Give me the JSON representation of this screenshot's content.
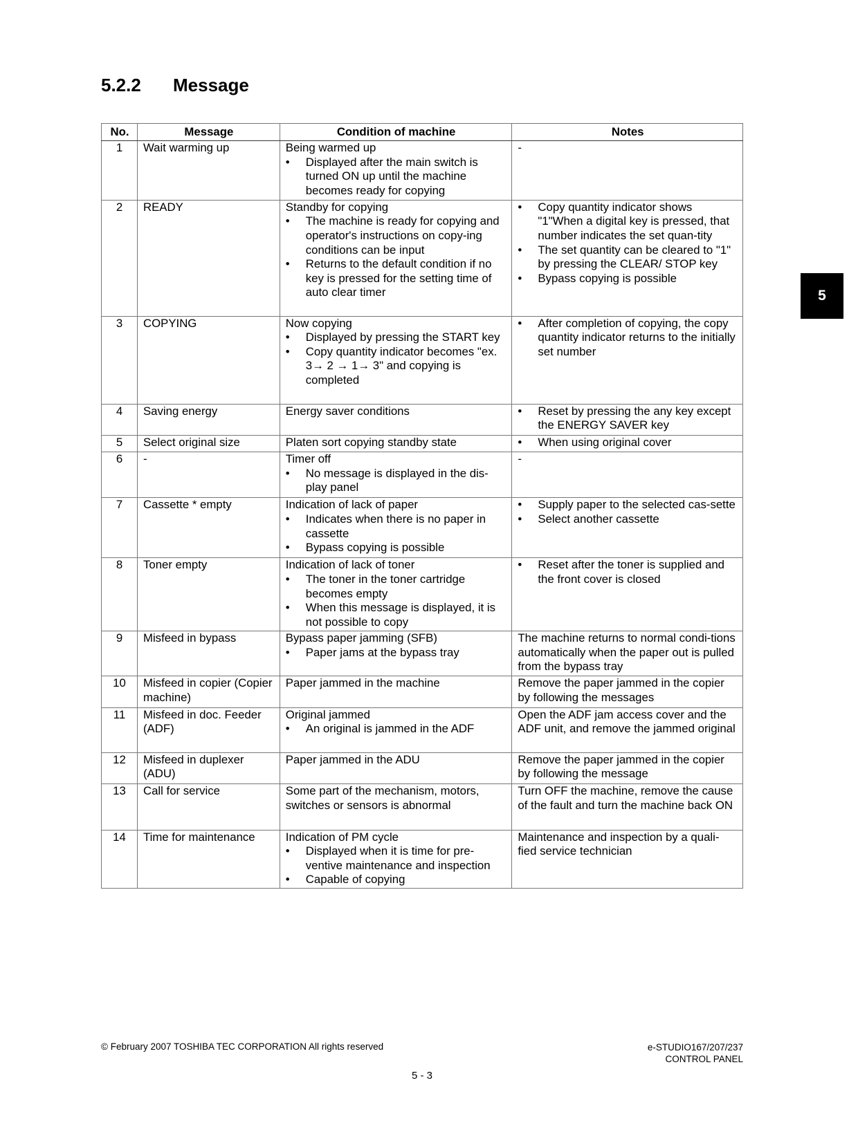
{
  "section": {
    "number": "5.2.2",
    "title": "Message"
  },
  "table": {
    "headers": [
      "No.",
      "Message",
      "Condition of machine",
      "Notes"
    ],
    "rows": [
      {
        "no": "1",
        "message": "Wait warming up",
        "condition": {
          "lead": "Being warmed up",
          "bullets": [
            "Displayed after the main switch is turned ON up until the machine becomes ready for copying"
          ]
        },
        "notes": {
          "lead": "-",
          "bullets": []
        }
      },
      {
        "no": "2",
        "message": "READY",
        "condition": {
          "lead": "Standby for copying",
          "bullets": [
            "The machine is ready for copying and operator's instructions on copy-ing conditions can be input",
            "Returns to the default condition if no key is pressed for the setting time of auto clear timer"
          ]
        },
        "notes": {
          "lead": "",
          "bullets": [
            "Copy quantity indicator shows \"1\"When a digital key is pressed, that number indicates the set quan-tity",
            "The set quantity can be cleared to \"1\" by pressing the CLEAR/ STOP key",
            "Bypass copying is possible"
          ]
        }
      },
      {
        "no": "3",
        "message": "COPYING",
        "condition": {
          "lead": "Now copying",
          "bullets": [
            "Displayed by pressing the START key",
            "Copy quantity indicator becomes \"ex. 3→ 2 → 1→ 3\" and copying is completed"
          ]
        },
        "notes": {
          "lead": "",
          "bullets": [
            "After completion of copying, the copy quantity indicator returns to the initially set number"
          ]
        }
      },
      {
        "no": "4",
        "message": "Saving energy",
        "condition": {
          "lead": "Energy saver conditions",
          "bullets": []
        },
        "notes": {
          "lead": "",
          "bullets": [
            "Reset by pressing the any key except the ENERGY SAVER key"
          ]
        }
      },
      {
        "no": "5",
        "message": "Select original size",
        "condition": {
          "lead": "Platen sort copying standby state",
          "bullets": []
        },
        "notes": {
          "lead": "",
          "bullets": [
            " When using original cover"
          ]
        }
      },
      {
        "no": "6",
        "message": "-",
        "condition": {
          "lead": "Timer off",
          "bullets": [
            "No message is displayed in the dis-play panel"
          ]
        },
        "notes": {
          "lead": "-",
          "bullets": []
        }
      },
      {
        "no": "7",
        "message": "Cassette * empty",
        "condition": {
          "lead": "Indication of lack of paper",
          "bullets": [
            "Indicates when there is no paper in cassette",
            "Bypass copying is possible"
          ]
        },
        "notes": {
          "lead": "",
          "bullets": [
            "Supply paper to the selected cas-sette",
            "Select another cassette"
          ]
        }
      },
      {
        "no": "8",
        "message": "Toner empty",
        "condition": {
          "lead": "Indication of lack of toner",
          "bullets": [
            "The toner in the toner cartridge becomes empty",
            "When this message is displayed, it is not possible to copy"
          ]
        },
        "notes": {
          "lead": "",
          "bullets": [
            "Reset after the toner is supplied and the front cover is closed"
          ]
        }
      },
      {
        "no": "9",
        "message": "Misfeed in bypass",
        "condition": {
          "lead": "Bypass paper jamming (SFB)",
          "bullets": [
            "Paper jams at the bypass tray"
          ]
        },
        "notes": {
          "lead": "The machine returns to normal condi-tions automatically when the paper out is pulled from the bypass tray",
          "bullets": []
        }
      },
      {
        "no": "10",
        "message": "Misfeed in copier (Copier machine)",
        "condition": {
          "lead": "Paper jammed in the machine",
          "bullets": []
        },
        "notes": {
          "lead": "Remove the paper jammed in the copier by following the messages",
          "bullets": []
        }
      },
      {
        "no": "11",
        "message": "Misfeed in doc. Feeder (ADF)",
        "condition": {
          "lead": "Original jammed",
          "bullets": [
            "An original is jammed in the ADF"
          ]
        },
        "notes": {
          "lead": "Open the ADF jam access cover and the ADF unit, and remove the jammed original",
          "bullets": []
        }
      },
      {
        "no": "12",
        "message": "Misfeed in duplexer (ADU)",
        "condition": {
          "lead": "Paper jammed in the ADU",
          "bullets": []
        },
        "notes": {
          "lead": "Remove the paper jammed in the copier by following the message",
          "bullets": []
        }
      },
      {
        "no": "13",
        "message": "Call for service",
        "condition": {
          "lead": "Some part of the mechanism, motors, switches or sensors is abnormal",
          "bullets": []
        },
        "notes": {
          "lead": "Turn OFF the machine, remove the cause of the fault and turn the machine back ON",
          "bullets": []
        }
      },
      {
        "no": "14",
        "message": "Time for maintenance",
        "condition": {
          "lead": "Indication of PM cycle",
          "bullets": [
            "Displayed when it is time for pre-ventive maintenance and inspection",
            "Capable of copying"
          ]
        },
        "notes": {
          "lead": "Maintenance and inspection by a quali-fied service technician",
          "bullets": []
        }
      }
    ]
  },
  "side_tab": {
    "label": "5"
  },
  "footer": {
    "copyright": "© February 2007 TOSHIBA TEC CORPORATION All rights reserved",
    "model": "e-STUDIO167/207/237",
    "chapter": "CONTROL PANEL",
    "page": "5 - 3"
  }
}
